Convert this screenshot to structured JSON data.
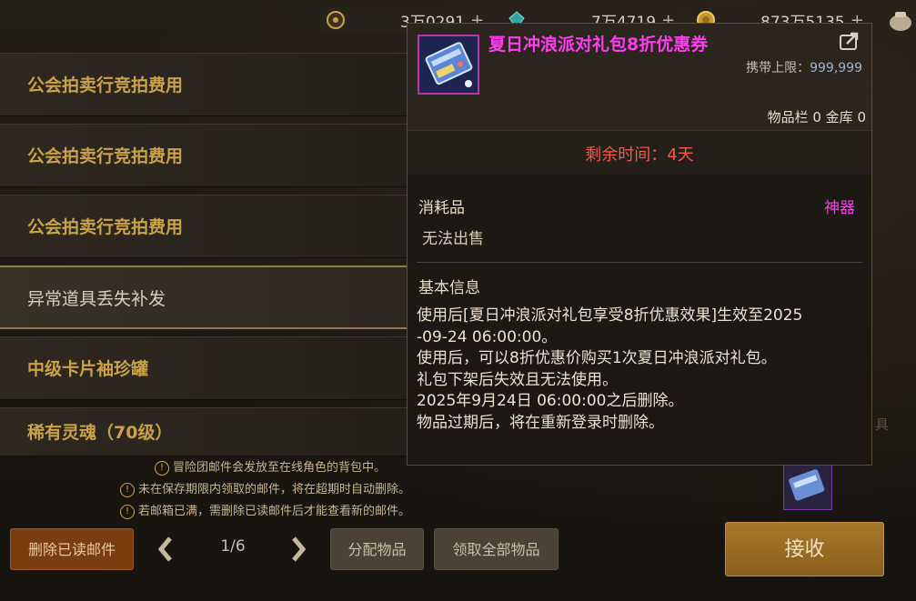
{
  "currencies": [
    {
      "icon": "target-coin-icon",
      "value": "3万0291",
      "plus": "+"
    },
    {
      "icon": "crystal-icon",
      "value": "7万4719",
      "plus": "+"
    },
    {
      "icon": "gold-coin-icon",
      "value": "873万5135",
      "plus": "+"
    }
  ],
  "mail_list": [
    {
      "label": "公会拍卖行竞拍费用",
      "selected": false
    },
    {
      "label": "公会拍卖行竞拍费用",
      "selected": false
    },
    {
      "label": "公会拍卖行竞拍费用",
      "selected": false
    },
    {
      "label": "异常道具丢失补发",
      "selected": true
    },
    {
      "label": "中级卡片袖珍罐",
      "selected": false
    },
    {
      "label": "稀有灵魂（70级）",
      "selected": false
    }
  ],
  "notices": [
    "冒险团邮件会发放至在线角色的背包中。",
    "未在保存期限内领取的邮件，将在超期时自动删除。",
    "若邮箱已满，需删除已读邮件后才能查看新的邮件。"
  ],
  "footer": {
    "delete_read": "删除已读邮件",
    "page": "1/6",
    "assign": "分配物品",
    "take_all": "领取全部物品",
    "receive": "接收"
  },
  "background_fragments": {
    "item_label_tail": "具"
  },
  "tooltip": {
    "title": "夏日冲浪派对礼包8折优惠券",
    "limit_label": "携带上限：",
    "limit_value": "999,999",
    "storage": "物品栏 0 金库 0",
    "remaining": "剩余时间：4天",
    "category": "消耗品",
    "rarity": "神器",
    "sellable": "无法出售",
    "section_title": "基本信息",
    "description": [
      "使用后[夏日冲浪派对礼包享受8折优惠效果]生效至2025",
      "-09-24 06:00:00。",
      "使用后，可以8折优惠价购买1次夏日冲浪派对礼包。",
      "礼包下架后失效且无法使用。",
      "2025年9月24日 06:00:00之后删除。",
      "物品过期后，将在重新登录时删除。"
    ]
  },
  "colors": {
    "title_magenta": "#ff3cf0",
    "remaining_red": "#f25a4a",
    "list_gold": "#c9a24a",
    "receive_gold": "#a8772a",
    "delete_orange": "#7a3d10"
  }
}
